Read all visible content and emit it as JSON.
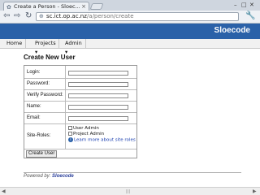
{
  "browser": {
    "tab_title": "Create a Person - Sloec...",
    "tab_close": "×",
    "url_host": "sc.ict.op.ac.nz",
    "url_path": "/a/person/create"
  },
  "site": {
    "title": "Sloecode",
    "menu": [
      {
        "label": "Home"
      },
      {
        "label": "Projects ▾"
      },
      {
        "label": "Admin ▾"
      }
    ]
  },
  "form": {
    "title": "Create New User",
    "fields": {
      "login": {
        "label": "Login:",
        "value": ""
      },
      "password": {
        "label": "Password:",
        "value": ""
      },
      "verify_password": {
        "label": "Verify Password:",
        "value": ""
      },
      "name": {
        "label": "Name:",
        "value": ""
      },
      "email": {
        "label": "Email:",
        "value": ""
      }
    },
    "site_roles": {
      "label": "Site-Roles:",
      "options": [
        {
          "label": "User Admin",
          "checked": false
        },
        {
          "label": "Project Admin",
          "checked": false
        }
      ],
      "learn_more": "Learn more about site roles"
    },
    "submit_label": "Create User"
  },
  "footer": {
    "prefix": "Powered by:",
    "brand": "Sloecode"
  }
}
